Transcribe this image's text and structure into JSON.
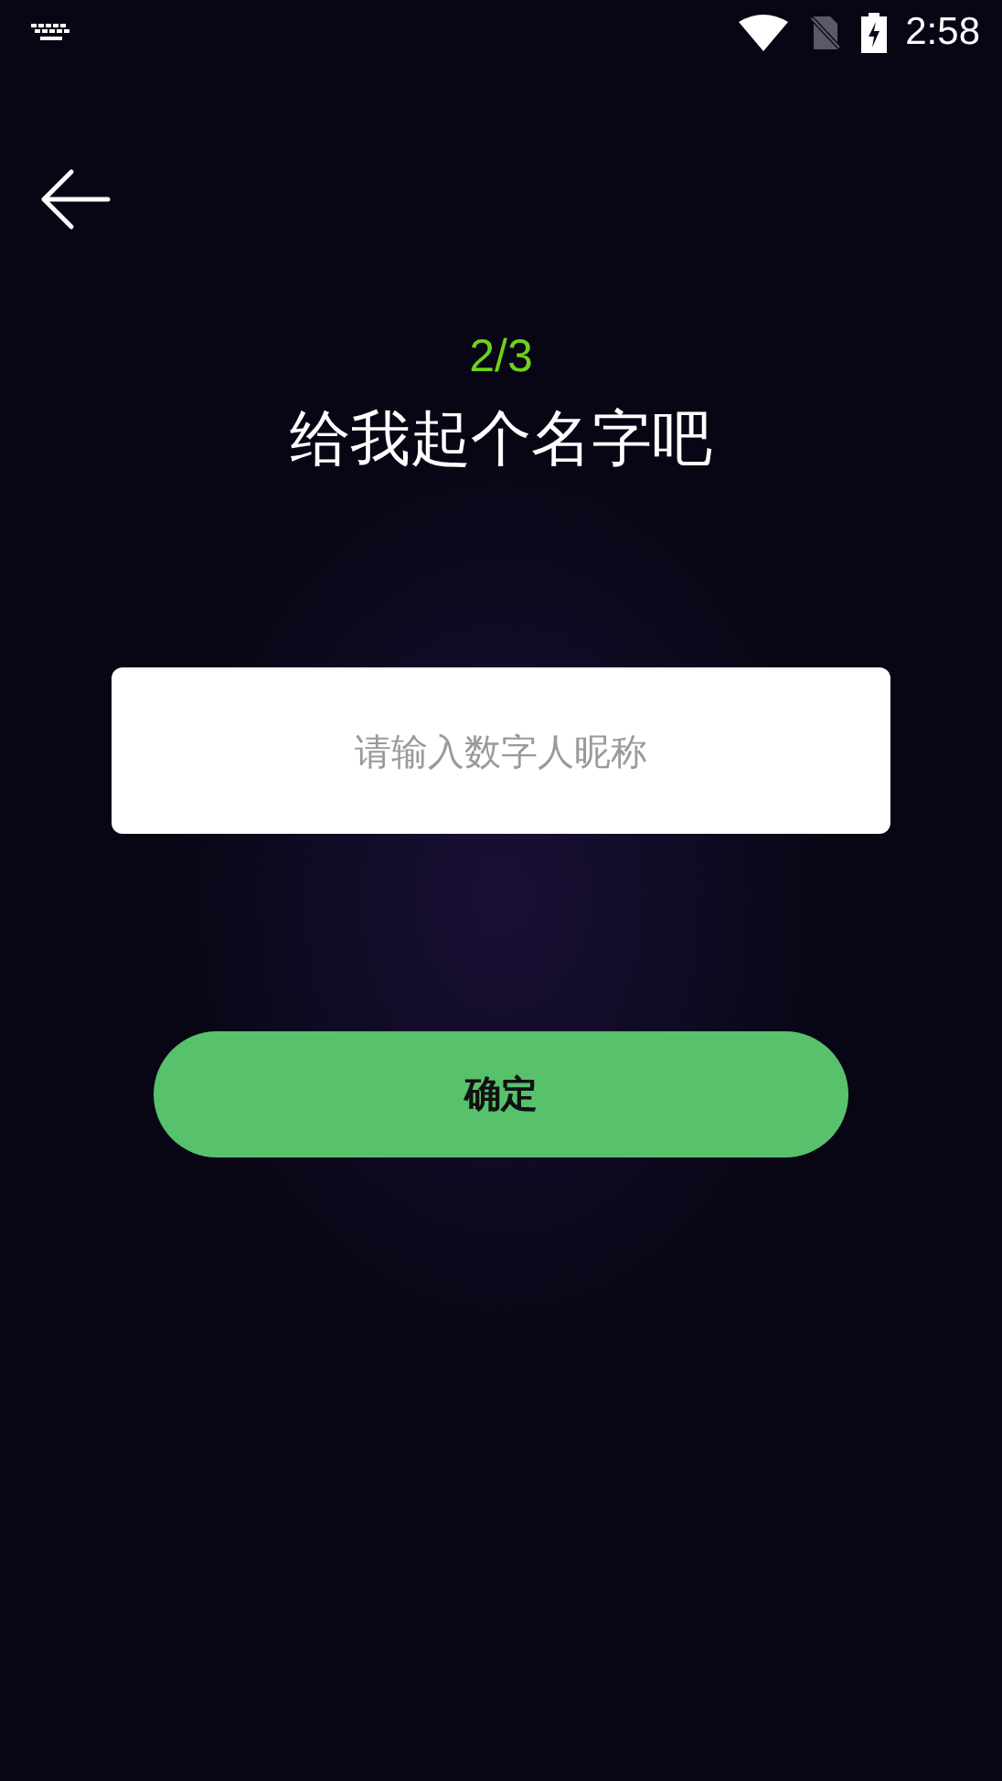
{
  "status_bar": {
    "time": "2:58"
  },
  "step": "2/3",
  "title": "给我起个名字吧",
  "name_field": {
    "placeholder": "请输入数字人昵称"
  },
  "confirm_button": {
    "label": "确定"
  }
}
